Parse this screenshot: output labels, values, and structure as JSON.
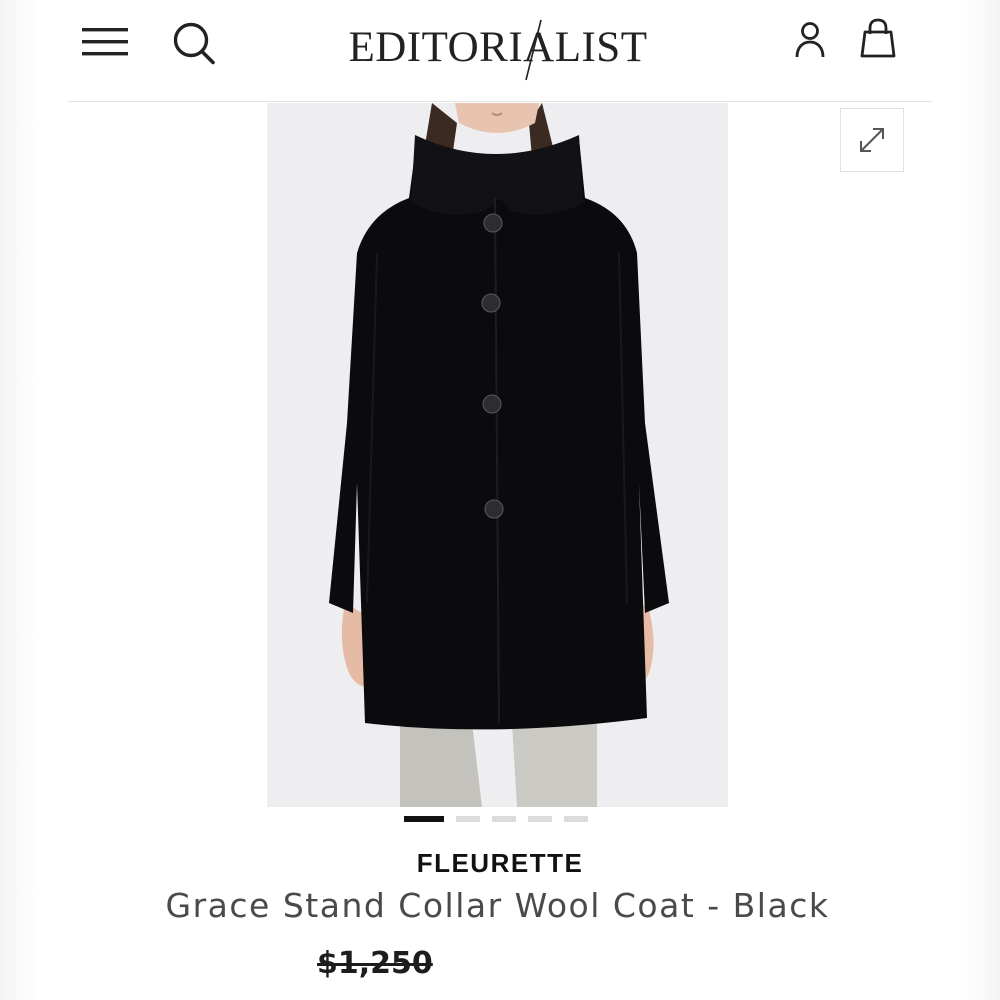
{
  "header": {
    "logo": "EDITORIALIST",
    "icons": {
      "menu": "hamburger-menu-icon",
      "search": "search-icon",
      "account": "user-account-icon",
      "bag": "shopping-bag-icon"
    }
  },
  "gallery": {
    "expand_icon": "expand-arrows-icon",
    "slides_total": 5,
    "active_slide": 1
  },
  "product": {
    "brand": "FLEURETTE",
    "name": "Grace Stand Collar Wool Coat - Black",
    "original_price": "$1,250"
  },
  "colors": {
    "text_primary": "#111111",
    "text_secondary": "#4a4a4a",
    "image_background": "#eeedef",
    "coat": "#0b0b0e",
    "active_dot": "#111111",
    "inactive_dot": "#dcdcdc"
  }
}
